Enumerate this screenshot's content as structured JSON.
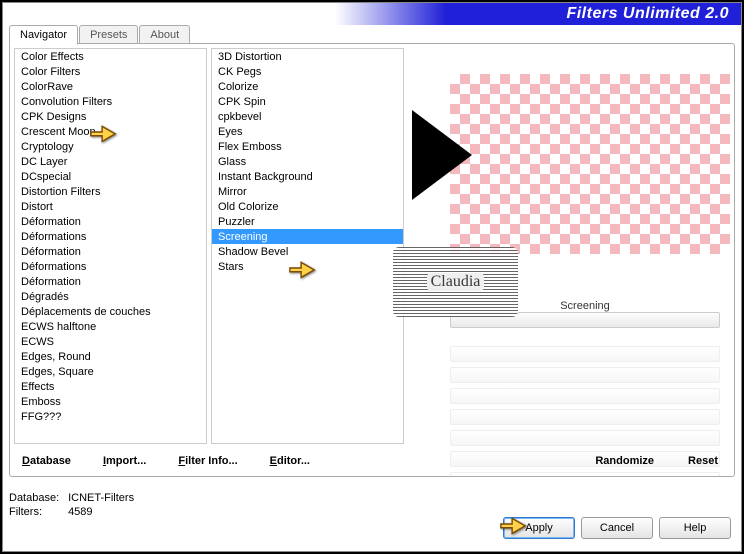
{
  "title": "Filters Unlimited 2.0",
  "tabs": {
    "navigator": "Navigator",
    "presets": "Presets",
    "about": "About"
  },
  "categories": [
    "Color Effects",
    "Color Filters",
    "ColorRave",
    "Convolution Filters",
    "CPK Designs",
    "Crescent Moon",
    "Cryptology",
    "DC Layer",
    "DCspecial",
    "Distortion Filters",
    "Distort",
    "Déformation",
    "Déformations",
    "Déformation",
    "Déformations",
    "Déformation",
    "Dégradés",
    "Déplacements de couches",
    "ECWS halftone",
    "ECWS",
    "Edges, Round",
    "Edges, Square",
    "Effects",
    "Emboss",
    "FFG???"
  ],
  "filters": [
    "3D Distortion",
    "CK Pegs",
    "Colorize",
    "CPK Spin",
    "cpkbevel",
    "Eyes",
    "Flex Emboss",
    "Glass",
    "Instant Background",
    "Mirror",
    "Old Colorize",
    "Puzzler",
    "Screening",
    "Shadow Bevel",
    "Stars"
  ],
  "selected_filter_index": 12,
  "param": {
    "name": "Screening"
  },
  "link_buttons": {
    "database": "Database",
    "import": "Import...",
    "filter_info": "Filter Info...",
    "editor": "Editor...",
    "randomize": "Randomize",
    "reset": "Reset"
  },
  "status": {
    "db_label": "Database:",
    "db_value": "ICNET-Filters",
    "filters_label": "Filters:",
    "filters_value": "4589"
  },
  "buttons": {
    "apply": "Apply",
    "cancel": "Cancel",
    "help": "Help"
  },
  "watermark": "Claudia"
}
